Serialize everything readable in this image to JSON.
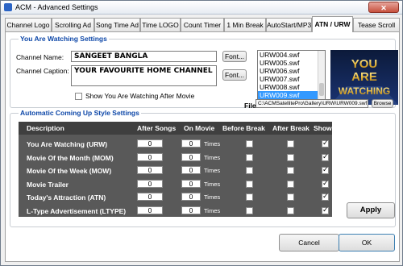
{
  "window": {
    "title": "ACM - Advanced Settings",
    "close": "✕"
  },
  "tabs": [
    {
      "label": "Channel Logo"
    },
    {
      "label": "Scrolling Ad"
    },
    {
      "label": "Song Time Ad"
    },
    {
      "label": "Time LOGO"
    },
    {
      "label": "Count Timer"
    },
    {
      "label": "1 Min Break"
    },
    {
      "label": "AutoStart/MP3"
    },
    {
      "label": "ATN / URW"
    },
    {
      "label": "Tease Scroll"
    }
  ],
  "active_tab": "ATN / URW",
  "watching": {
    "group_title": "You Are Watching Settings",
    "channel_name_label": "Channel Name:",
    "channel_name_value": "SANGEET BANGLA",
    "channel_caption_label": "Channel Caption:",
    "channel_caption_value": "YOUR FAVOURITE HOME CHANNEL",
    "font_button": "Font...",
    "show_after_movie_label": "Show You Are Watching After Movie",
    "show_after_movie_checked": false,
    "file_label": "File:",
    "file_path": "C:\\ACMSatellitePro\\Gallery\\URW\\URW009.swf",
    "browse_button": "Browse",
    "files": [
      "URW004.swf",
      "URW005.swf",
      "URW006.swf",
      "URW007.swf",
      "URW008.swf",
      "URW009.swf"
    ],
    "selected_file": "URW009.swf",
    "preview_text": [
      "YOU",
      "ARE",
      "WATCHING"
    ]
  },
  "coming_up": {
    "group_title": "Automatic Coming Up Style Settings",
    "headers": [
      "Description",
      "After Songs",
      "On Movie",
      "Before Break",
      "After Break",
      "Show"
    ],
    "times_label": "Times",
    "rows": [
      {
        "desc": "You Are Watching (URW)",
        "after_songs": "0",
        "on_movie": "0",
        "before_break": false,
        "after_break": false,
        "show": true
      },
      {
        "desc": "Movie Of the Month (MOM)",
        "after_songs": "0",
        "on_movie": "0",
        "before_break": false,
        "after_break": false,
        "show": true
      },
      {
        "desc": "Movie Of the Week (MOW)",
        "after_songs": "0",
        "on_movie": "0",
        "before_break": false,
        "after_break": false,
        "show": true
      },
      {
        "desc": "Movie Trailer",
        "after_songs": "0",
        "on_movie": "0",
        "before_break": false,
        "after_break": false,
        "show": true
      },
      {
        "desc": "Today's Attraction (ATN)",
        "after_songs": "0",
        "on_movie": "0",
        "before_break": false,
        "after_break": false,
        "show": true
      },
      {
        "desc": "L-Type Advertisement (LTYPE)",
        "after_songs": "0",
        "on_movie": "0",
        "before_break": false,
        "after_break": false,
        "show": true
      }
    ],
    "apply_button": "Apply"
  },
  "footer": {
    "cancel": "Cancel",
    "ok": "OK"
  },
  "colors": {
    "group_title": "#0d47a8",
    "table_bg": "#595959",
    "selection": "#3399ff"
  }
}
